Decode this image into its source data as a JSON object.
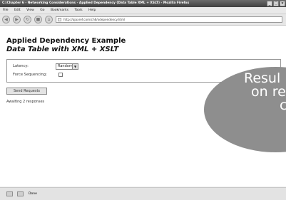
{
  "window": {
    "title": "C:\\Chapter 6 - Networking Considerations - Applied Dependency (Data Table XML + XSLT) - Mozilla Firefox",
    "title_right": "_ □ ×"
  },
  "menu": [
    "File",
    "Edit",
    "View",
    "Go",
    "Bookmarks",
    "Tools",
    "Help"
  ],
  "nav": {
    "url": "http://ajaxref.com/ch6/xdependency.html",
    "icons": [
      "back-icon",
      "forward-icon",
      "reload-icon",
      "stop-icon",
      "home-icon"
    ]
  },
  "page": {
    "heading1": "Applied Dependency Example",
    "heading2": "Data Table with XML + XSLT",
    "latency_label": "Latency:",
    "latency_value": "Random",
    "force_label": "Force Sequencing:",
    "send_button": "Send Requests",
    "status_message": "Awaiting 2 responses"
  },
  "callout": {
    "line1": "Resul",
    "line2": "on re",
    "line3": "c"
  },
  "statusbar": {
    "text": "Done"
  },
  "colors": {
    "callout": "#8e8e8e"
  }
}
